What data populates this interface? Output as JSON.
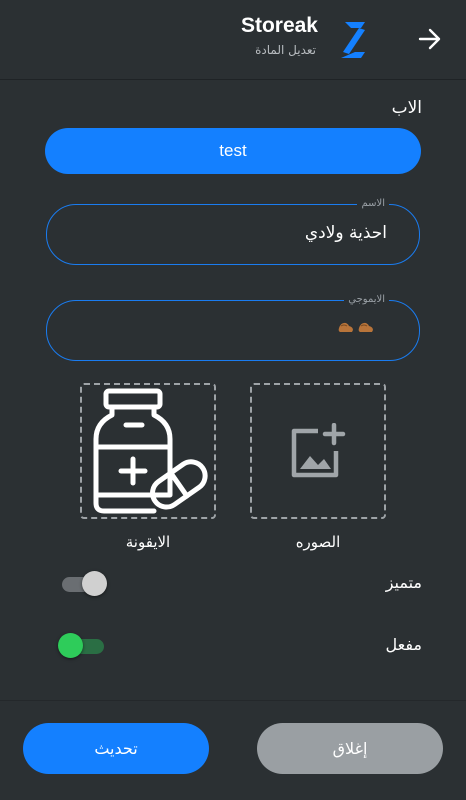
{
  "app": {
    "title": "Storeak",
    "subtitle": "تعديل المادة"
  },
  "icons": {
    "back": "arrow-right-icon",
    "logo": "storeak-logo-icon",
    "medicine": "medicine-bottle-icon",
    "add_photo": "add-photo-icon",
    "emoji": "shoe-emoji-icon"
  },
  "colors": {
    "accent": "#1480ff",
    "background": "#2b3033",
    "switch_on": "#2ecc5a",
    "switch_off": "#d0d0d0",
    "close_button": "#9a9fa3"
  },
  "form": {
    "parent_label": "الاب",
    "parent_value": "test",
    "name_legend": "الاسم",
    "name_value": "احذية ولادي",
    "emoji_legend": "الايموجي",
    "emoji_value": "👞👞",
    "icon_label": "الايقونة",
    "image_label": "الصوره",
    "featured_label": "متميز",
    "featured_on": false,
    "enabled_label": "مفعل",
    "enabled_on": true
  },
  "actions": {
    "update": "تحديث",
    "close": "إغلاق"
  }
}
